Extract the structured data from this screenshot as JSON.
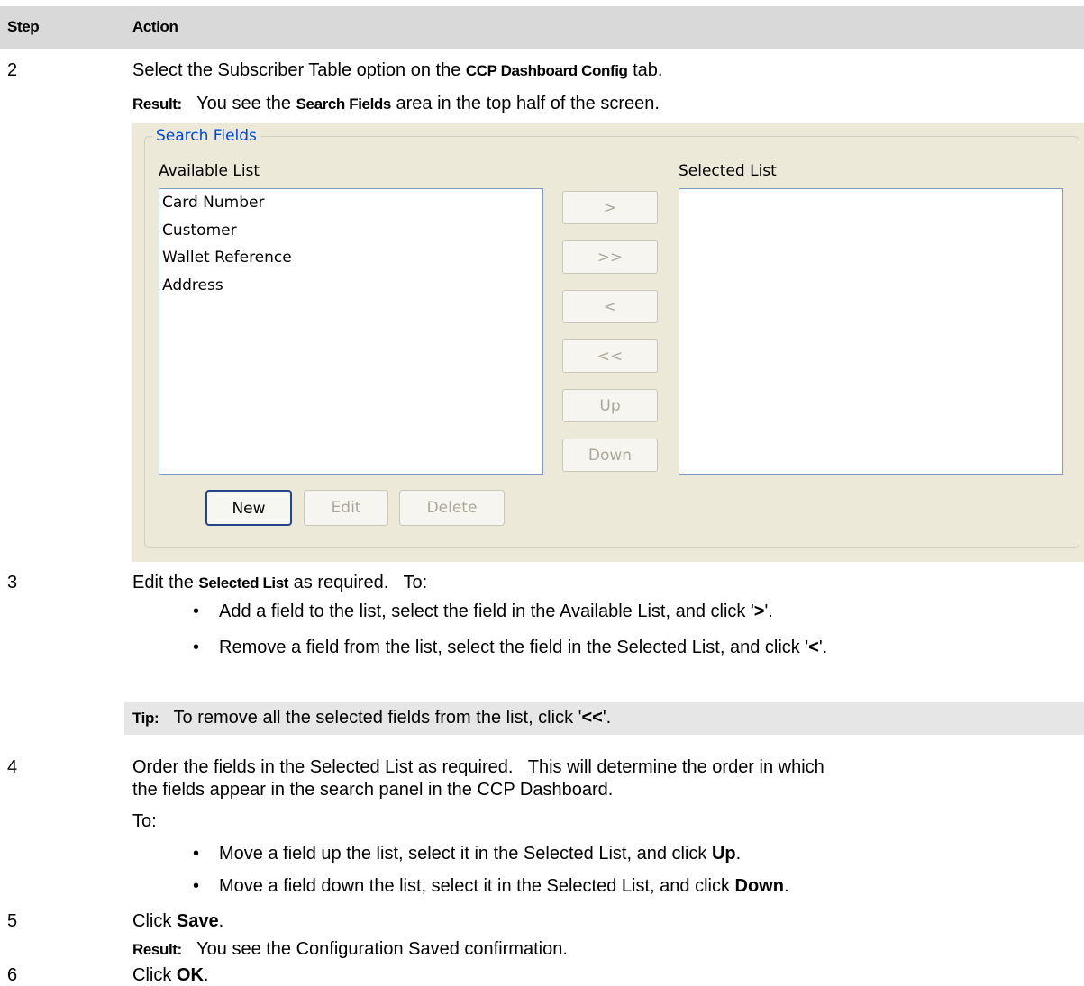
{
  "header": {
    "step": "Step",
    "action": "Action"
  },
  "step2": {
    "num": "2",
    "pre": "Select the Subscriber Table option on the ",
    "bold": "CCP Dashboard Config",
    "post": " tab.",
    "result_label": "Result:",
    "result_pre": "   You see the ",
    "result_bold": "Search Fields",
    "result_post": " area in the top half of the screen."
  },
  "screenshot": {
    "group_title": "Search Fields",
    "available_label": "Available List",
    "selected_label": "Selected List",
    "available_items": [
      "Card Number",
      "Customer",
      "Wallet Reference",
      "Address"
    ],
    "selected_items": [],
    "transfer_buttons": [
      ">",
      ">>",
      "<",
      "<<",
      "Up",
      "Down"
    ],
    "bottom_buttons": {
      "new": "New",
      "edit": "Edit",
      "delete": "Delete"
    }
  },
  "step3": {
    "num": "3",
    "pre": "Edit the ",
    "bold": "Selected List",
    "post": " as required.   To:",
    "bullets": [
      {
        "pre": "Add a field to the list, select the field in the Available List, and click '",
        "bold": ">",
        "post": "'."
      },
      {
        "pre": "Remove a field from the list, select the field in the Selected List, and click '",
        "bold": "<",
        "post": "'."
      }
    ],
    "tip_label": "Tip:",
    "tip_pre": "   To remove all the selected fields from the list, click '",
    "tip_bold": "<<",
    "tip_post": "'."
  },
  "step4": {
    "num": "4",
    "line1": "Order the fields in the Selected List as required.   This will determine the order in which",
    "line2": "the fields appear in the search panel in the CCP Dashboard.",
    "to": "To:",
    "bullets": [
      {
        "pre": "Move a field up the list, select it in the Selected List, and click ",
        "bold": "Up",
        "post": "."
      },
      {
        "pre": "Move a field down the list, select it in the Selected List, and click ",
        "bold": "Down",
        "post": "."
      }
    ]
  },
  "step5": {
    "num": "5",
    "pre": "Click ",
    "bold": "Save",
    "post": ".",
    "result_label": "Result:",
    "result_text": "   You see the Configuration Saved confirmation."
  },
  "step6": {
    "num": "6",
    "pre": "Click ",
    "bold": "OK",
    "post": "."
  }
}
